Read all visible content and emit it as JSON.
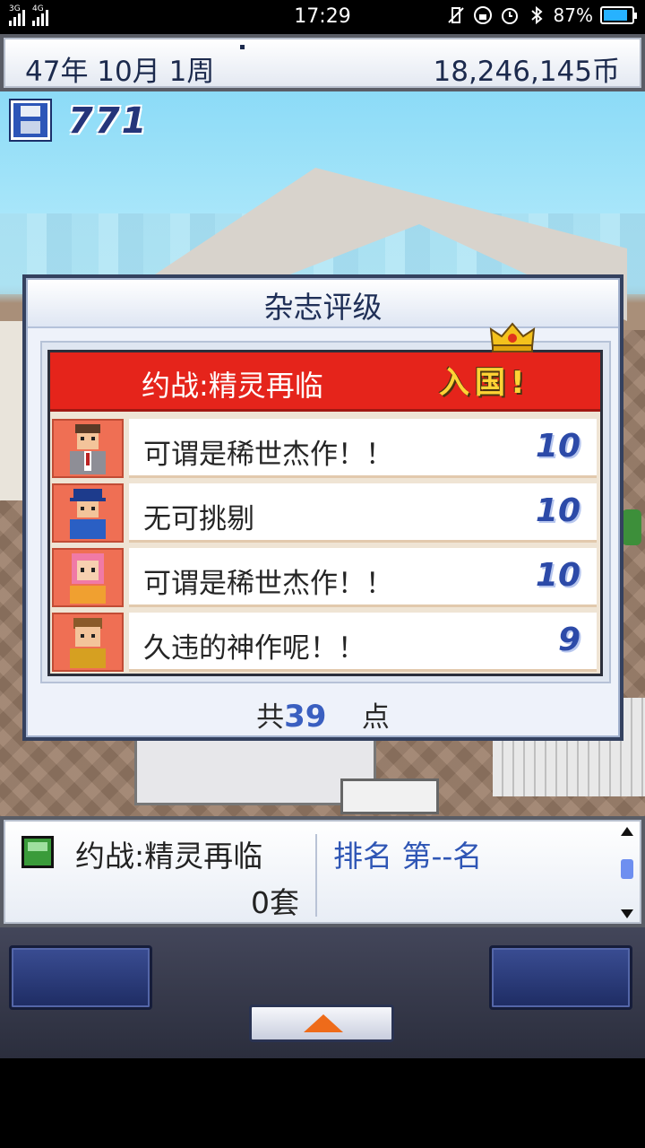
{
  "status_bar": {
    "network_1": "3G",
    "network_2": "4G",
    "time": "17:29",
    "battery": "87%",
    "battery_fill": 0.87
  },
  "top_bar": {
    "date": "47年 10月 1周",
    "money": "18,246,145币"
  },
  "save": {
    "count": "771"
  },
  "dialog": {
    "title": "杂志评级",
    "game_title": "约战:精灵再临",
    "rank_badge": "入国!",
    "reviews": [
      {
        "reviewer": "businessman",
        "comment": "可谓是稀世杰作！！",
        "score": "10"
      },
      {
        "reviewer": "cap-boy",
        "comment": "无可挑剔",
        "score": "10"
      },
      {
        "reviewer": "pink-hair-girl",
        "comment": "可谓是稀世杰作！！",
        "score": "10"
      },
      {
        "reviewer": "brown-hair-man",
        "comment": "久违的神作呢！！",
        "score": "9"
      }
    ],
    "total_prefix": "共",
    "total_points": "39",
    "total_suffix": "点"
  },
  "bottom_info": {
    "game_title": "约战:精灵再临",
    "sets": "0套",
    "rank": "排名 第--名"
  },
  "colors": {
    "header_red": "#e5241b",
    "score_blue": "#2c4aa8",
    "rank_gold": "#ffd335",
    "avatar_bg": "#ef6f54"
  }
}
